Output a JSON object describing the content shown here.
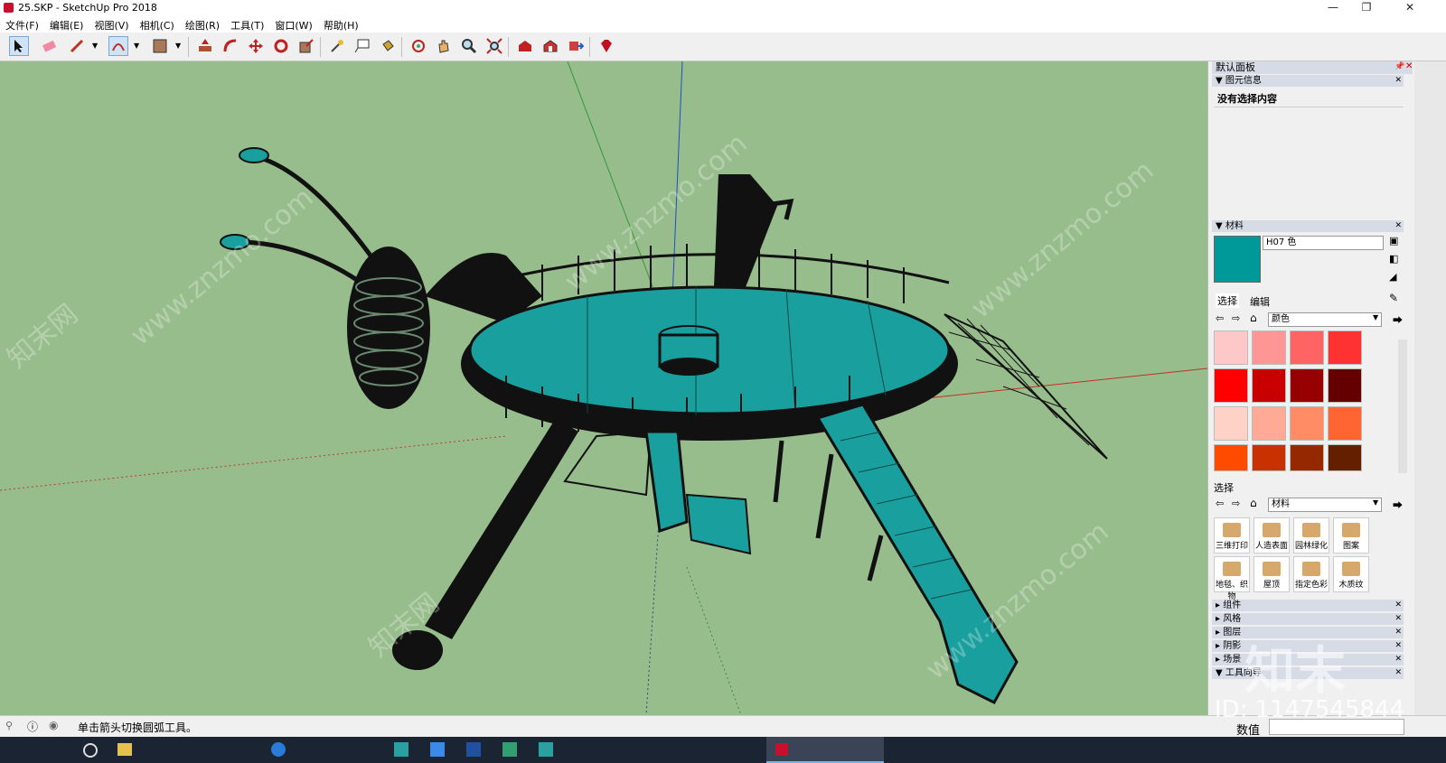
{
  "window": {
    "title": "25.SKP - SketchUp Pro 2018",
    "controls": [
      "—",
      "❐",
      "✕"
    ]
  },
  "menu": [
    "文件(F)",
    "编辑(E)",
    "视图(V)",
    "相机(C)",
    "绘图(R)",
    "工具(T)",
    "窗口(W)",
    "帮助(H)"
  ],
  "toolbar": {
    "icons": [
      "select-icon",
      "eraser-icon",
      "pencil-icon",
      "arc-icon",
      "rectangle-icon",
      "push-pull-icon",
      "follow-me-icon",
      "move-icon",
      "rotate-icon",
      "scale-icon",
      "tape-measure-icon",
      "text-icon",
      "paint-bucket-icon",
      "orbit-icon",
      "pan-icon",
      "zoom-icon",
      "zoom-extents-icon",
      "warehouse-icon",
      "extension-warehouse-icon",
      "send-to-layout-icon",
      "ruby-icon"
    ]
  },
  "viewport": {
    "watermarks": [
      "www.znzmo.com",
      "知末网",
      "www.znzmo.com",
      "www.znzmo.com",
      "www.znzmo.com",
      "知末网"
    ]
  },
  "panel": {
    "title": "默认面板",
    "entity_info": {
      "title": "图元信息",
      "text": "没有选择内容"
    },
    "materials": {
      "title": "材料",
      "current_name": "H07 色",
      "current_color": "#009999",
      "tab_select": "选择",
      "tab_edit": "编辑",
      "category": "颜色",
      "colors": [
        "#ffc8c8",
        "#ff9696",
        "#ff6464",
        "#ff3232",
        "#ff0000",
        "#c80000",
        "#960000",
        "#640000",
        "#ffd2c8",
        "#ffaa96",
        "#ff8c64",
        "#ff6432",
        "#ff4b00",
        "#c83200",
        "#962800",
        "#641e00"
      ],
      "second_label": "选择",
      "second_category": "材料",
      "folders": [
        "三维打印",
        "人造表面",
        "园林绿化",
        "图案",
        "地毯、织物",
        "屋顶",
        "指定色彩",
        "木质纹"
      ]
    },
    "collapsed_sections": [
      "组件",
      "风格",
      "图层",
      "阴影",
      "场景",
      "工具向导"
    ]
  },
  "status": {
    "message": "单击箭头切换圆弧工具。",
    "value_label": "数值"
  },
  "overlay": {
    "logo": "知末",
    "id": "ID: 1147545844"
  }
}
